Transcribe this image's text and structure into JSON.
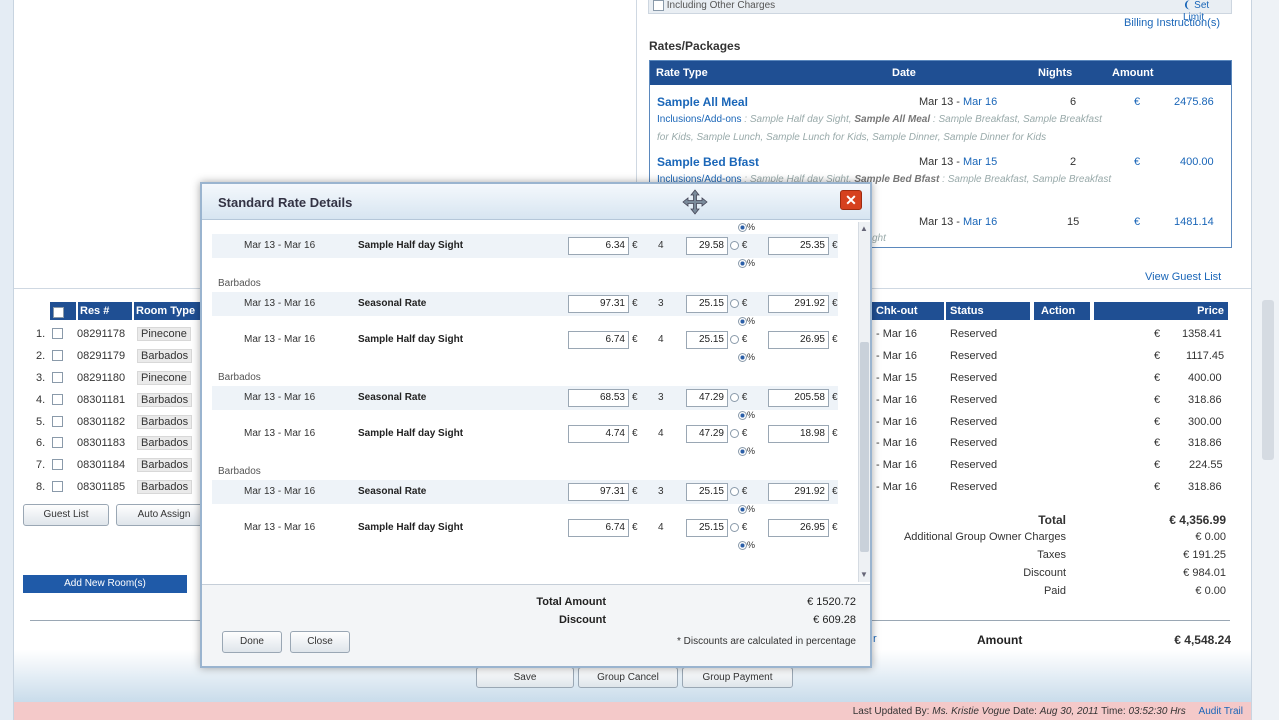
{
  "top": {
    "other_charges_label": "Including Other Charges",
    "set_limit_link": "Set Limit",
    "billing_link": "Billing Instruction(s)",
    "rates_title": "Rates/Packages",
    "rates_headers": {
      "rate_type": "Rate Type",
      "date": "Date",
      "nights": "Nights",
      "amount": "Amount"
    },
    "rates": [
      {
        "name": "Sample All Meal",
        "date_from": "Mar 13 - ",
        "date_to": "Mar 16",
        "nights": "6",
        "cur": "€",
        "amount": "2475.86",
        "inc_label": "Inclusions/Add-ons",
        "inc_text": " : Sample Half day Sight, ",
        "inc_bold": "Sample All Meal",
        "inc_rest": " : Sample Breakfast, Sample Breakfast",
        "inc_line2": "for Kids, Sample Lunch, Sample Lunch for Kids, Sample Dinner, Sample Dinner for Kids"
      },
      {
        "name": "Sample Bed Bfast",
        "date_from": "Mar 13 - ",
        "date_to": "Mar 15",
        "nights": "2",
        "cur": "€",
        "amount": "400.00",
        "inc_label": "Inclusions/Add-ons",
        "inc_text": " : Sample Half day Sight, ",
        "inc_bold": "Sample Bed Bfast",
        "inc_rest": " : Sample Breakfast, Sample Breakfast"
      },
      {
        "date_from": "Mar 13 - ",
        "date_to": "Mar 16",
        "nights": "15",
        "cur": "€",
        "amount": "1481.14",
        "tail": "ght"
      }
    ],
    "view_guest_list": "View Guest List"
  },
  "table": {
    "headers": {
      "res": "Res #",
      "room_type": "Room Type",
      "chk_out": "Chk-out",
      "status": "Status",
      "action": "Action",
      "price": "Price"
    },
    "rows": [
      {
        "n": "1.",
        "res": "08291178",
        "room": "Pinecone",
        "out": "- Mar 16",
        "status": "Reserved",
        "cur": "€",
        "price": "1358.41"
      },
      {
        "n": "2.",
        "res": "08291179",
        "room": "Barbados",
        "out": "- Mar 16",
        "status": "Reserved",
        "cur": "€",
        "price": "1117.45"
      },
      {
        "n": "3.",
        "res": "08291180",
        "room": "Pinecone",
        "out": "- Mar 15",
        "status": "Reserved",
        "cur": "€",
        "price": "400.00"
      },
      {
        "n": "4.",
        "res": "08301181",
        "room": "Barbados",
        "out": "- Mar 16",
        "status": "Reserved",
        "cur": "€",
        "price": "318.86"
      },
      {
        "n": "5.",
        "res": "08301182",
        "room": "Barbados",
        "out": "- Mar 16",
        "status": "Reserved",
        "cur": "€",
        "price": "300.00"
      },
      {
        "n": "6.",
        "res": "08301183",
        "room": "Barbados",
        "out": "- Mar 16",
        "status": "Reserved",
        "cur": "€",
        "price": "318.86"
      },
      {
        "n": "7.",
        "res": "08301184",
        "room": "Barbados",
        "out": "- Mar 16",
        "status": "Reserved",
        "cur": "€",
        "price": "224.55"
      },
      {
        "n": "8.",
        "res": "08301185",
        "room": "Barbados",
        "out": "- Mar 16",
        "status": "Reserved",
        "cur": "€",
        "price": "318.86"
      }
    ],
    "guest_list_btn": "Guest List",
    "auto_assign_btn": "Auto Assign",
    "add_rooms_btn": "Add New Room(s)"
  },
  "summary": {
    "total_label": "Total",
    "total_value": "€ 4,356.99",
    "additional_label": "Additional Group Owner Charges",
    "additional_value": "€ 0.00",
    "taxes_label": "Taxes",
    "taxes_value": "€ 191.25",
    "discount_label": "Discount",
    "discount_value": "€ 984.01",
    "paid_label": "Paid",
    "paid_value": "€ 0.00",
    "amount_label": "Amount",
    "amount_value": "€ 4,548.24",
    "partial_r": "r"
  },
  "buttons": {
    "save": "Save",
    "group_cancel": "Group Cancel",
    "group_payment": "Group Payment"
  },
  "footer": {
    "text": "Last Updated By: ",
    "user": "Ms. Kristie Vogue",
    "date_label": " Date: ",
    "date": "Aug 30, 2011",
    "time_label": " Time: ",
    "time": "03:52:30 Hrs",
    "audit": "Audit Trail"
  },
  "modal": {
    "title": "Standard Rate Details",
    "close_glyph": "✕",
    "pct": "%",
    "cur": "€",
    "rows": [
      {
        "group": "",
        "date": "Mar 13 - Mar 16",
        "name": "Sample Half day Sight",
        "rate": "6.34",
        "nights": "4",
        "disc": "29.58",
        "total": "25.35"
      },
      {
        "group": "Barbados",
        "date": "Mar 13 - Mar 16",
        "name": "Seasonal Rate",
        "rate": "97.31",
        "nights": "3",
        "disc": "25.15",
        "total": "291.92"
      },
      {
        "group": "",
        "date": "Mar 13 - Mar 16",
        "name": "Sample Half day Sight",
        "rate": "6.74",
        "nights": "4",
        "disc": "25.15",
        "total": "26.95"
      },
      {
        "group": "Barbados",
        "date": "Mar 13 - Mar 16",
        "name": "Seasonal Rate",
        "rate": "68.53",
        "nights": "3",
        "disc": "47.29",
        "total": "205.58"
      },
      {
        "group": "",
        "date": "Mar 13 - Mar 16",
        "name": "Sample Half day Sight",
        "rate": "4.74",
        "nights": "4",
        "disc": "47.29",
        "total": "18.98"
      },
      {
        "group": "Barbados",
        "date": "Mar 13 - Mar 16",
        "name": "Seasonal Rate",
        "rate": "97.31",
        "nights": "3",
        "disc": "25.15",
        "total": "291.92"
      },
      {
        "group": "",
        "date": "Mar 13 - Mar 16",
        "name": "Sample Half day Sight",
        "rate": "6.74",
        "nights": "4",
        "disc": "25.15",
        "total": "26.95"
      }
    ],
    "total_amount_label": "Total Amount",
    "total_amount_value": "€ 1520.72",
    "discount_label": "Discount",
    "discount_value": "€ 609.28",
    "note": "* Discounts are calculated in percentage",
    "done_btn": "Done",
    "close_btn": "Close"
  }
}
